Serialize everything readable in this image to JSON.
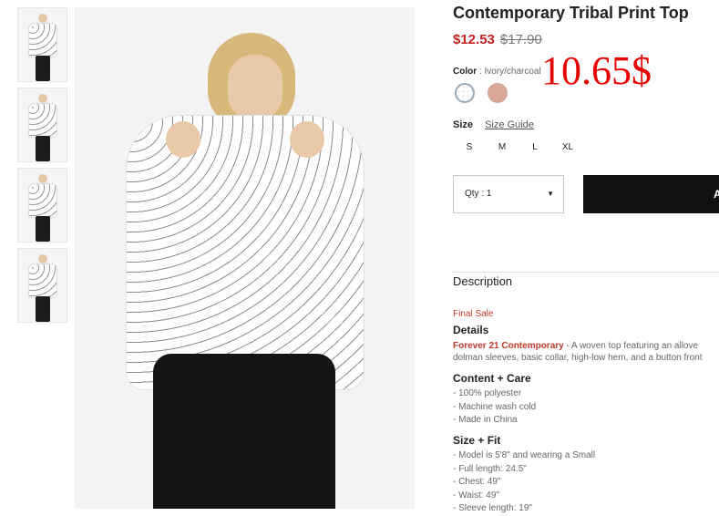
{
  "product": {
    "title": "Contemporary Tribal Print Top",
    "sale_price": "$12.53",
    "original_price": "$17.90"
  },
  "annotation": "10.65$",
  "color": {
    "label": "Color",
    "separator": ":",
    "value": "Ivory/charcoal"
  },
  "size": {
    "label": "Size",
    "guide_label": "Size Guide",
    "options": [
      "S",
      "M",
      "L",
      "XL"
    ]
  },
  "quantity": {
    "label": "Qty : 1"
  },
  "add_button": {
    "label": "A"
  },
  "description": {
    "heading": "Description",
    "final_sale": "Final Sale",
    "details_heading": "Details",
    "brand": "Forever 21 Contemporary",
    "details_line1": " - A woven top featuring an allove",
    "details_line2": "dolman sleeves, basic collar, high-low hem, and a button front",
    "content_heading": "Content + Care",
    "content_items": [
      "- 100% polyester",
      "- Machine wash cold",
      "- Made in China"
    ],
    "fit_heading": "Size + Fit",
    "fit_items": [
      "- Model is 5'8\" and wearing a Small",
      "- Full length: 24.5\"",
      "- Chest: 49\"",
      "- Waist: 49\"",
      "- Sleeve length: 19\""
    ]
  }
}
